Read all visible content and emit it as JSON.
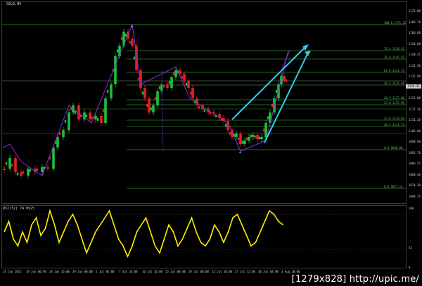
{
  "chart": {
    "symbol": "GOLD,H4",
    "current_price": "1139.32",
    "price_ticks": [
      "1172.80",
      "1166.70",
      "1160.60",
      "1154.60",
      "1148.45",
      "1142.50",
      "1135.90",
      "1129.45",
      "1123.00",
      "1117.20",
      "1111.20",
      "1105.00",
      "1098.90",
      "1092.70",
      "1086.55",
      "1080.40",
      "1074.30",
      "1068.15"
    ],
    "fibo_labels": [
      {
        "text": "100.0 1171.22"
      },
      {
        "text": "76.4 1150.61"
      },
      {
        "text": "76.4 1145.92"
      },
      {
        "text": "61.8 1141.75"
      },
      {
        "text": "38.2 1135.40"
      },
      {
        "text": "38.2 1127.86"
      },
      {
        "text": "23.6 1125.09"
      },
      {
        "text": "23.6 1116.04"
      },
      {
        "text": "38.2 1114.72"
      },
      {
        "text": "0.0 1096.86"
      },
      {
        "text": "0.0 1077.13"
      }
    ],
    "time_ticks": [
      "14 Jun 2015",
      "19 Jun 00:00",
      "24 Jun 16:00",
      "29 Jun 08:00",
      "2 Jul 04:00",
      "7 Jul 20:00",
      "10 Jul 16:00",
      "15 Jul 08:00",
      "20 Jul 00:00",
      "22 Jul 16:00",
      "27 Jul 12:00",
      "30 Jul 04:00",
      "3 Aug 20:00"
    ],
    "colors": {
      "bull": "#1fbf3a",
      "bear": "#e02020",
      "fibo": "#2f8a2f",
      "trend": "#33ccee",
      "zigzag": "#8a2be2",
      "rsi": "#ffee00"
    }
  },
  "indicator": {
    "title": "RSI(32) 74.0925",
    "levels": [
      "100",
      "32",
      "0"
    ]
  },
  "watermark": "[1279x828] http://upic.me/"
}
